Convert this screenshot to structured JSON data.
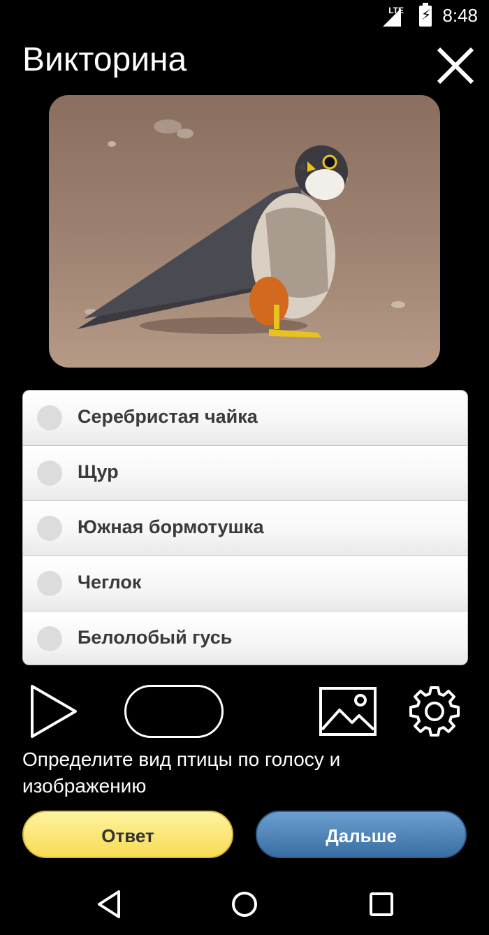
{
  "status": {
    "network": "LTE",
    "time": "8:48"
  },
  "header": {
    "title": "Викторина"
  },
  "quiz": {
    "options": [
      {
        "label": "Серебристая чайка"
      },
      {
        "label": "Щур"
      },
      {
        "label": "Южная бормотушка"
      },
      {
        "label": "Чеглок"
      },
      {
        "label": "Белолобый гусь"
      }
    ],
    "hint": "Определите вид птицы по голосу и изображению"
  },
  "buttons": {
    "answer": "Ответ",
    "next": "Дальше"
  },
  "icons": [
    "lte-signal-icon",
    "battery-charging-icon",
    "close-icon",
    "play-icon",
    "image-icon",
    "gear-icon",
    "back-icon",
    "home-icon",
    "recents-icon"
  ]
}
